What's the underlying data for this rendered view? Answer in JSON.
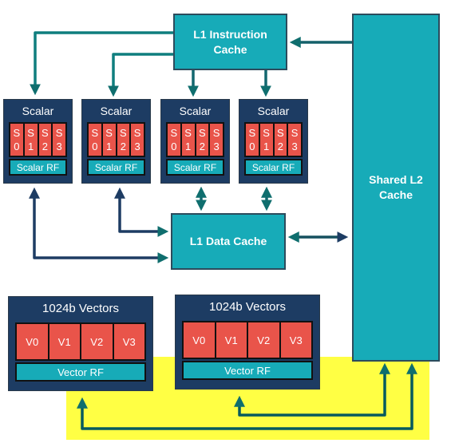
{
  "l1_instruction_cache": "L1 Instruction Cache",
  "l1_data_cache": "L1 Data Cache",
  "shared_l2_cache": "Shared L2 Cache",
  "scalar_units": [
    {
      "title": "Scalar",
      "regs": [
        "S0",
        "S1",
        "S2",
        "S3"
      ],
      "rf": "Scalar RF"
    },
    {
      "title": "Scalar",
      "regs": [
        "S0",
        "S1",
        "S2",
        "S3"
      ],
      "rf": "Scalar RF"
    },
    {
      "title": "Scalar",
      "regs": [
        "S0",
        "S1",
        "S2",
        "S3"
      ],
      "rf": "Scalar RF"
    },
    {
      "title": "Scalar",
      "regs": [
        "S0",
        "S1",
        "S2",
        "S3"
      ],
      "rf": "Scalar RF"
    }
  ],
  "vector_units": [
    {
      "title": "1024b Vectors",
      "regs": [
        "V0",
        "V1",
        "V2",
        "V3"
      ],
      "rf": "Vector RF"
    },
    {
      "title": "1024b Vectors",
      "regs": [
        "V0",
        "V1",
        "V2",
        "V3"
      ],
      "rf": "Vector RF"
    }
  ],
  "colors": {
    "cache": "#17abb8",
    "unit": "#1d3c63",
    "register": "#e9544a",
    "highlight": "#ffff44",
    "arrow": "#0f6e6e"
  }
}
